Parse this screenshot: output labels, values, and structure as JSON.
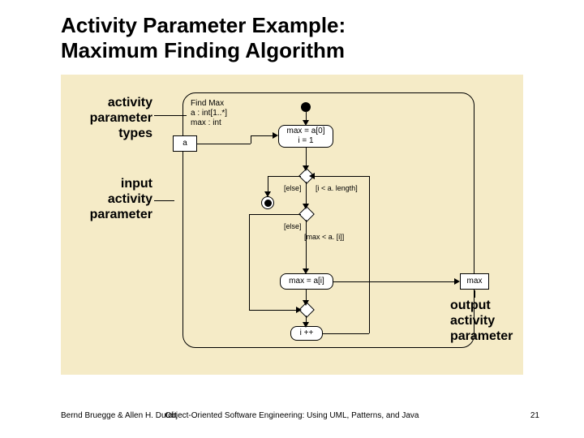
{
  "title_line1": "Activity Parameter Example:",
  "title_line2": "Maximum Finding Algorithm",
  "annotations": {
    "types": "activity\nparameter\ntypes",
    "input": "input\nactivity\nparameter",
    "output": "output\nactivity\nparameter"
  },
  "header": {
    "name": "Find Max",
    "param_a": "a : int[1..*]",
    "param_max": "max : int"
  },
  "nodes": {
    "a": "a",
    "init": "max = a[0]\ni = 1",
    "guard_else_top": "[else]",
    "guard_len": "[i < a. length]",
    "guard_else_mid": "[else]",
    "guard_cmp": "[max < a. [i]]",
    "assign": "max = a[i]",
    "max_out": "max",
    "inc": "i ++"
  },
  "footer": {
    "left": "Bernd Bruegge & Allen H. Dutoit",
    "center": "Object-Oriented Software Engineering: Using UML, Patterns, and Java",
    "page": "21"
  }
}
